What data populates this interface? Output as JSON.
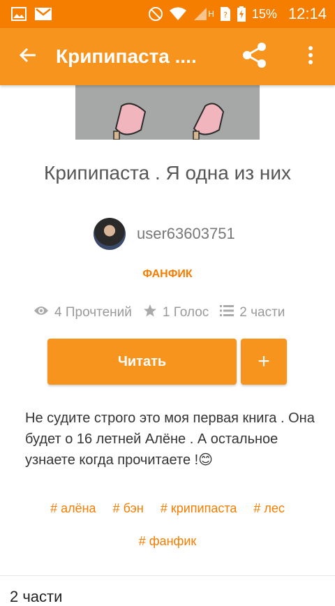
{
  "status_bar": {
    "battery": "15%",
    "time": "12:14",
    "network_label": "H",
    "icons": [
      "image-icon",
      "gmail-icon",
      "do-not-disturb-icon",
      "wifi-icon",
      "signal-icon",
      "sim-icon",
      "battery-icon"
    ]
  },
  "app_bar": {
    "title": "Крипипаста ....",
    "back_icon": "arrow-left-icon",
    "share_icon": "share-icon",
    "more_icon": "more-vertical-icon"
  },
  "story": {
    "title": "Крипипаста . Я одна из них",
    "author": "user63603751",
    "category": "ФАНФИК",
    "stats": {
      "reads": "4 Прочтений",
      "votes": "1 Голос",
      "parts": "2 части"
    },
    "read_button": "Читать",
    "add_button": "+",
    "description": "Не судите строго это моя первая книга . Она будет о 16 летней Алёне . А остальное узнаете когда прочитаете !😊",
    "tags": [
      "# алёна",
      "# бэн",
      "# крипипаста",
      "# лес",
      "# фанфик"
    ]
  },
  "parts_section": {
    "heading": "2 части"
  },
  "colors": {
    "status_bar": "#f57d00",
    "app_bar": "#f7941d",
    "accent": "#f57d00"
  }
}
